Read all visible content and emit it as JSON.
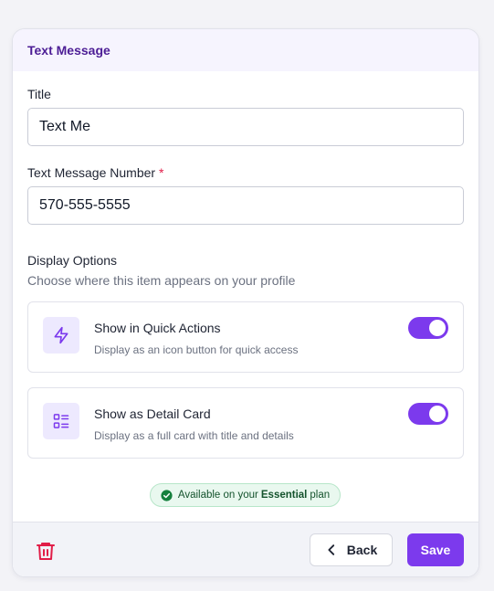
{
  "header": {
    "title": "Text Message"
  },
  "form": {
    "title_label": "Title",
    "title_value": "Text Me",
    "number_label": "Text Message Number",
    "required_mark": "*",
    "number_value": "570-555-5555"
  },
  "display_options": {
    "heading": "Display Options",
    "subheading": "Choose where this item appears on your profile",
    "items": [
      {
        "title": "Show in Quick Actions",
        "description": "Display as an icon button for quick access",
        "icon": "lightning-icon",
        "enabled": true
      },
      {
        "title": "Show as Detail Card",
        "description": "Display as a full card with title and details",
        "icon": "detail-list-icon",
        "enabled": true
      }
    ]
  },
  "plan_badge": {
    "prefix": "Available on your",
    "plan": "Essential",
    "suffix": "plan"
  },
  "footer": {
    "back_label": "Back",
    "save_label": "Save"
  },
  "colors": {
    "accent": "#7c3aed",
    "header_title": "#4c1d95",
    "danger": "#e11d48",
    "success": "#15803d"
  }
}
